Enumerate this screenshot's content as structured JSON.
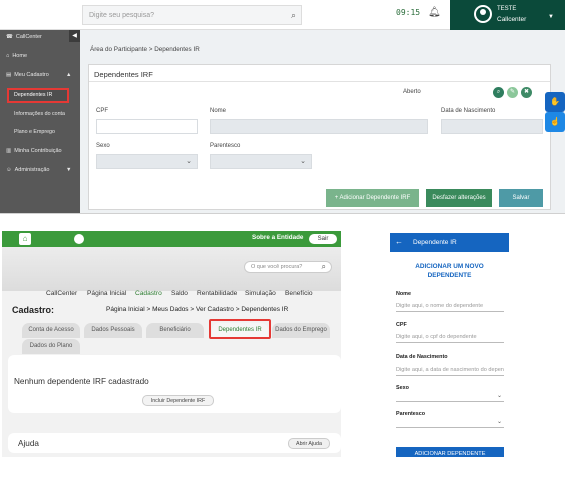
{
  "desktop": {
    "search_placeholder": "Digite seu pesquisa?",
    "clock": "09:15",
    "user": {
      "name": "TESTE",
      "role": "Callcenter"
    },
    "sidebar": [
      {
        "icon": "phone-icon",
        "label": "CallCenter"
      },
      {
        "icon": "home-icon",
        "label": "Home"
      },
      {
        "icon": "id-card-icon",
        "label": "Meu Cadastro"
      },
      {
        "icon": "",
        "label": "Dependentes IR"
      },
      {
        "icon": "",
        "label": "Informações do conta"
      },
      {
        "icon": "",
        "label": "Plano e Emprego"
      },
      {
        "icon": "chart-icon",
        "label": "Minha Contribuição"
      },
      {
        "icon": "users-icon",
        "label": "Administração"
      }
    ],
    "breadcrumb": "Área do Participante  >  Dependentes IR",
    "card_title": "Dependentes IRF",
    "status": "Aberto",
    "fields": {
      "cpf": "CPF",
      "nome": "Nome",
      "nascimento": "Data de Nascimento",
      "sexo": "Sexo",
      "parentesco": "Parentesco"
    },
    "buttons": {
      "add": "+  Adicionar Dependente IRF",
      "undo": "Desfazer alterações",
      "save": "Salvar"
    },
    "colors": {
      "dark_green": "#0b4a3a",
      "button_green": "#6aac7f",
      "undo_green": "#3a8a5c",
      "save_teal": "#4e9aa6"
    }
  },
  "legacy": {
    "sobre": "Sobre a Entidade",
    "sair": "Sair",
    "search_placeholder": "O que você procura?",
    "nav": [
      "CallCenter",
      "Página Inicial",
      "Cadastro",
      "Saldo",
      "Rentabilidade",
      "Simulação",
      "Benefício"
    ],
    "section": "Cadastro:",
    "path": "Página Inicial > Meus Dados > Ver Cadastro > Dependentes IR",
    "tabs": [
      "Conta de Acesso",
      "Dados Pessoais",
      "Beneficiário",
      "Dependentes IR",
      "Dados do Emprego",
      "Dados do Plano"
    ],
    "empty": "Nenhum dependente IRF cadastrado",
    "include": "Incluir Dependente IRF",
    "help": "Ajuda",
    "open_help": "Abrir Ajuda"
  },
  "mobile": {
    "title": "Dependente IR",
    "heading": [
      "ADICIONAR UM NOVO",
      "DEPENDENTE"
    ],
    "fields": [
      {
        "label": "Nome",
        "placeholder": "Digite aqui, o nome do dependente"
      },
      {
        "label": "CPF",
        "placeholder": "Digite aqui, o cpf do dependente"
      },
      {
        "label": "Data de Nascimento",
        "placeholder": "Digite aqui, a data de nascimento do dependente"
      }
    ],
    "selects": [
      "Sexo",
      "Parentesco"
    ],
    "add_button": "ADICIONAR DEPENDENTE"
  }
}
